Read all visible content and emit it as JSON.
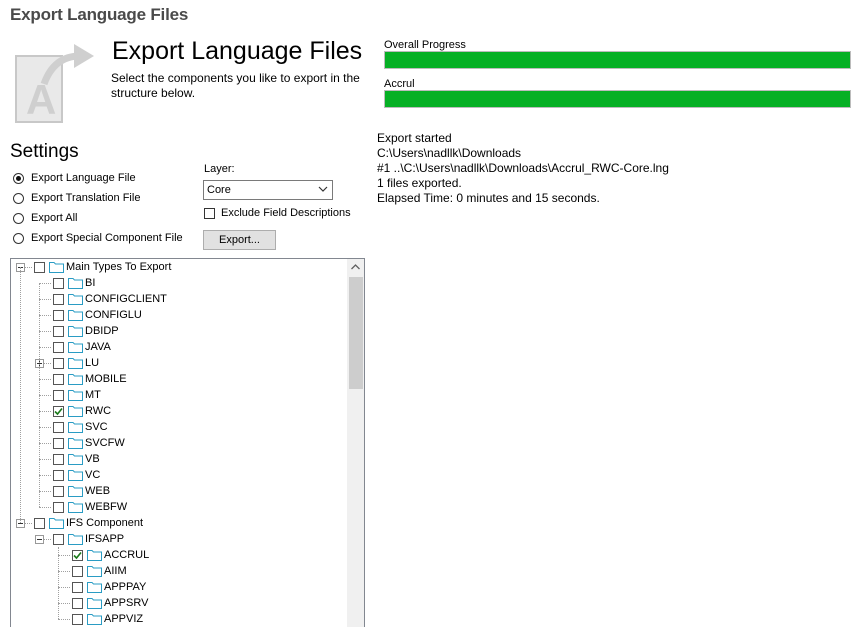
{
  "window": {
    "title": "Export Language Files"
  },
  "header": {
    "title": "Export Language Files",
    "description": "Select the components you like to export in the structure below.",
    "icon": "export-document-icon"
  },
  "progress": {
    "overall_label": "Overall Progress",
    "overall_value": 1.0,
    "item_label": "Accrul",
    "item_value": 1.0,
    "fill_color": "#06b025"
  },
  "settings": {
    "heading": "Settings",
    "options": [
      {
        "label": "Export Language File",
        "selected": true
      },
      {
        "label": "Export Translation File",
        "selected": false
      },
      {
        "label": "Export All",
        "selected": false
      },
      {
        "label": "Export Special Component File",
        "selected": false
      }
    ],
    "layer_label": "Layer:",
    "layer_value": "Core",
    "exclude_label": "Exclude Field Descriptions",
    "exclude_checked": false,
    "export_button": "Export..."
  },
  "log": [
    "Export started",
    "C:\\Users\\nadllk\\Downloads",
    "#1 ..\\C:\\Users\\nadllk\\Downloads\\Accrul_RWC-Core.lng",
    "1 files exported.",
    "Elapsed Time: 0 minutes and 15 seconds."
  ],
  "tree": [
    {
      "label": "Main Types To Export",
      "level": 0,
      "checked": false,
      "expander": "minus"
    },
    {
      "label": "BI",
      "level": 1,
      "checked": false
    },
    {
      "label": "CONFIGCLIENT",
      "level": 1,
      "checked": false
    },
    {
      "label": "CONFIGLU",
      "level": 1,
      "checked": false
    },
    {
      "label": "DBIDP",
      "level": 1,
      "checked": false
    },
    {
      "label": "JAVA",
      "level": 1,
      "checked": false
    },
    {
      "label": "LU",
      "level": 1,
      "checked": false,
      "expander": "plus"
    },
    {
      "label": "MOBILE",
      "level": 1,
      "checked": false
    },
    {
      "label": "MT",
      "level": 1,
      "checked": false
    },
    {
      "label": "RWC",
      "level": 1,
      "checked": true
    },
    {
      "label": "SVC",
      "level": 1,
      "checked": false
    },
    {
      "label": "SVCFW",
      "level": 1,
      "checked": false
    },
    {
      "label": "VB",
      "level": 1,
      "checked": false
    },
    {
      "label": "VC",
      "level": 1,
      "checked": false
    },
    {
      "label": "WEB",
      "level": 1,
      "checked": false
    },
    {
      "label": "WEBFW",
      "level": 1,
      "checked": false
    },
    {
      "label": "IFS Component",
      "level": 0,
      "checked": false,
      "expander": "minus"
    },
    {
      "label": "IFSAPP",
      "level": 1,
      "checked": false,
      "expander": "minus"
    },
    {
      "label": "ACCRUL",
      "level": 2,
      "checked": true
    },
    {
      "label": "AIIM",
      "level": 2,
      "checked": false
    },
    {
      "label": "APPPAY",
      "level": 2,
      "checked": false
    },
    {
      "label": "APPSRV",
      "level": 2,
      "checked": false
    },
    {
      "label": "APPVIZ",
      "level": 2,
      "checked": false
    }
  ]
}
